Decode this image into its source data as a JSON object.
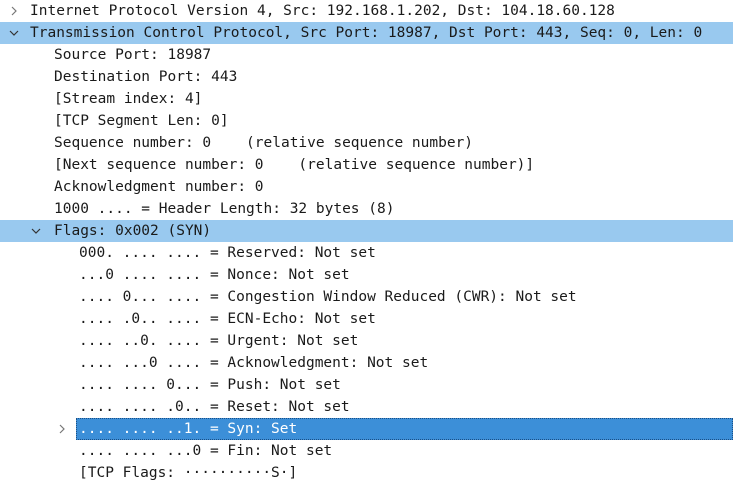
{
  "rows": [
    {
      "text": "Internet Protocol Version 4, Src: 192.168.1.202, Dst: 104.18.60.128"
    },
    {
      "text": "Transmission Control Protocol, Src Port: 18987, Dst Port: 443, Seq: 0, Len: 0"
    },
    {
      "text": "Source Port: 18987"
    },
    {
      "text": "Destination Port: 443"
    },
    {
      "text": "[Stream index: 4]"
    },
    {
      "text": "[TCP Segment Len: 0]"
    },
    {
      "text": "Sequence number: 0    (relative sequence number)"
    },
    {
      "text": "[Next sequence number: 0    (relative sequence number)]"
    },
    {
      "text": "Acknowledgment number: 0"
    },
    {
      "text": "1000 .... = Header Length: 32 bytes (8)"
    },
    {
      "text": "Flags: 0x002 (SYN)"
    },
    {
      "text": "000. .... .... = Reserved: Not set"
    },
    {
      "text": "...0 .... .... = Nonce: Not set"
    },
    {
      "text": ".... 0... .... = Congestion Window Reduced (CWR): Not set"
    },
    {
      "text": ".... .0.. .... = ECN-Echo: Not set"
    },
    {
      "text": ".... ..0. .... = Urgent: Not set"
    },
    {
      "text": ".... ...0 .... = Acknowledgment: Not set"
    },
    {
      "text": ".... .... 0... = Push: Not set"
    },
    {
      "text": ".... .... .0.. = Reset: Not set"
    },
    {
      "text": ".... .... ..1. = Syn: Set"
    },
    {
      "text": ".... .... ...0 = Fin: Not set"
    },
    {
      "text": "[TCP Flags: ··········S·]"
    }
  ],
  "colors": {
    "selection_light": "#99c9ef",
    "selection_bar": "#3c8fd8",
    "arrow": "#555555",
    "text": "#1a1a1a"
  },
  "icons": {
    "collapsed": "chevron-right-icon",
    "expanded": "chevron-down-icon"
  }
}
